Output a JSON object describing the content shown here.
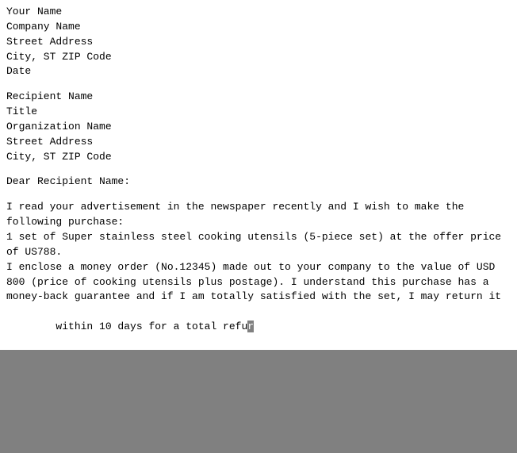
{
  "letter": {
    "sender": {
      "name": "Your Name",
      "company": "Company Name",
      "street": "Street Address",
      "city": "City, ST ZIP Code",
      "date": "Date"
    },
    "recipient": {
      "name": "Recipient Name",
      "title": "Title",
      "org": "Organization Name",
      "street": "Street Address",
      "city": "City, ST ZIP Code"
    },
    "salutation": "Dear Recipient Name:",
    "body_line1": "I read your advertisement in the newspaper recently and I wish to make the",
    "body_line2": "following purchase:",
    "body_line3": "1 set of Super stainless steel cooking utensils (5-piece set) at the offer price",
    "body_line4": "of US788.",
    "body_line5": "I enclose a money order (No.12345) made out to your company to the value of USD",
    "body_line6": "800 (price of cooking utensils plus postage). I understand this purchase has a",
    "body_line7": "money-back guarantee and if I am totally satisfied with the set, I may return it",
    "body_line8_normal": "within 10 days for a total refu",
    "body_line8_selected": "r"
  }
}
